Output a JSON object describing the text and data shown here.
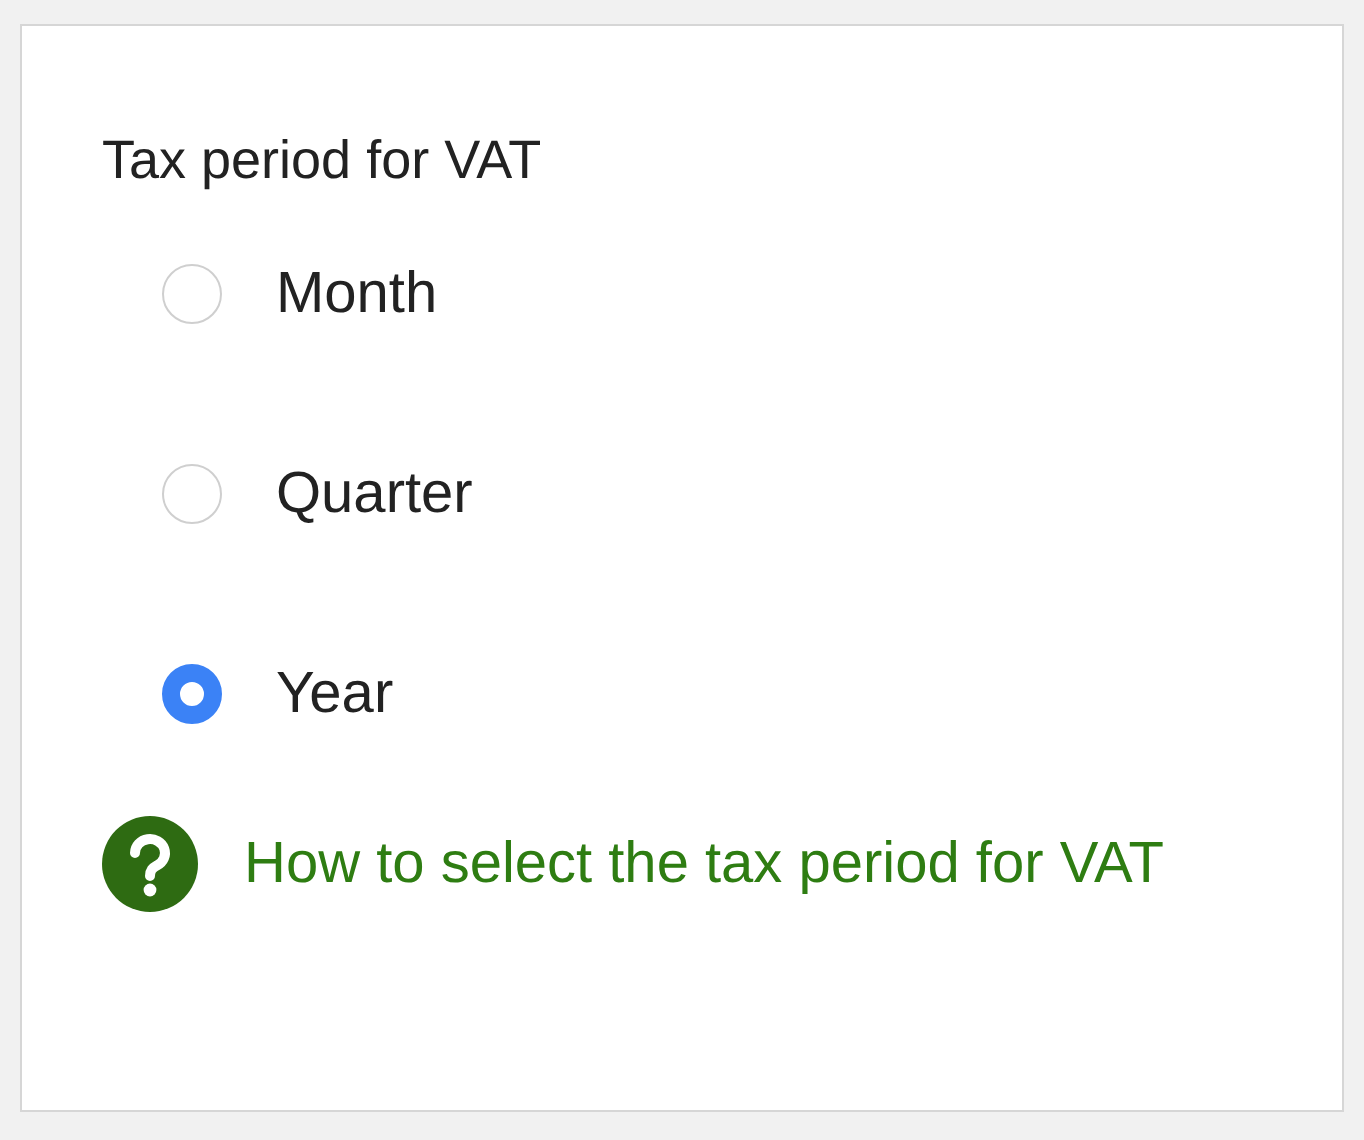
{
  "title": "Tax period for VAT",
  "options": [
    {
      "label": "Month",
      "selected": false
    },
    {
      "label": "Quarter",
      "selected": false
    },
    {
      "label": "Year",
      "selected": true
    }
  ],
  "help_link": "How to select the tax period for VAT"
}
